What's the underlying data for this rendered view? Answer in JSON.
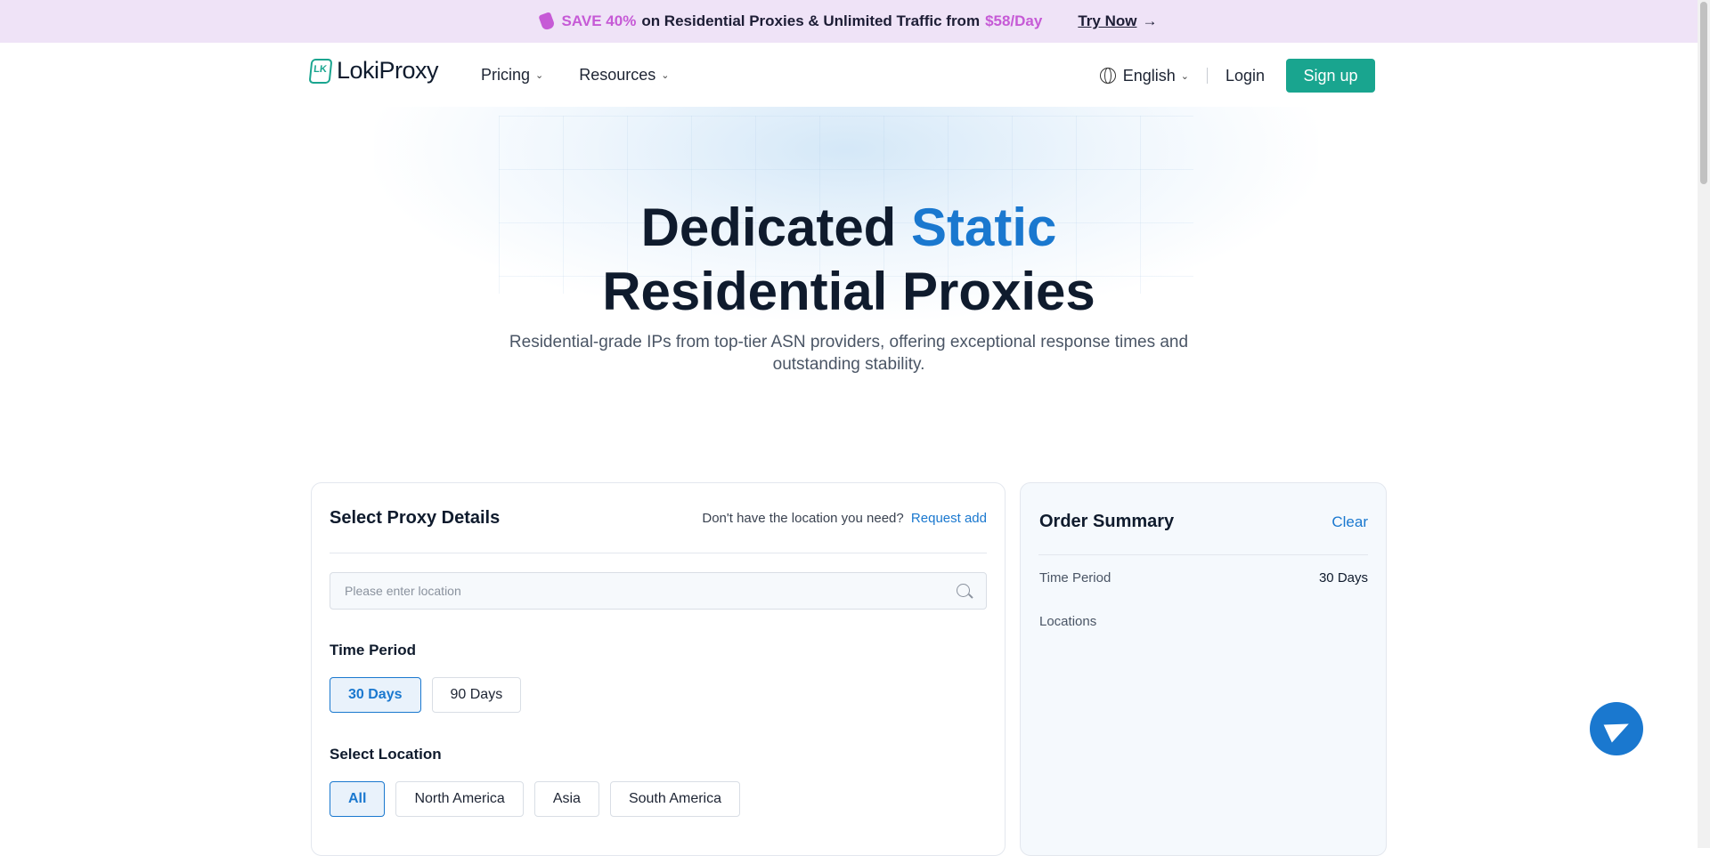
{
  "promo": {
    "save": "SAVE 40%",
    "text": "on Residential Proxies & Unlimited Traffic from",
    "price": "$58/Day",
    "cta": "Try Now",
    "arrow": "→",
    "accent_color": "#c65ad6"
  },
  "header": {
    "logo": "LokiProxy",
    "nav": [
      {
        "label": "Pricing"
      },
      {
        "label": "Resources"
      }
    ],
    "chevron": "⌄",
    "language": "English",
    "login": "Login",
    "signup": "Sign up",
    "brand_color": "#19a58f"
  },
  "hero": {
    "title_part1": "Dedicated ",
    "title_accent": "Static",
    "title_part2": " Residential Proxies",
    "subtitle": "Residential-grade IPs from top-tier ASN providers, offering exceptional response times and outstanding stability.",
    "accent_color": "#1a78cf"
  },
  "proxy_details": {
    "title": "Select Proxy Details",
    "request_prefix": "Don't have the location you need?",
    "request_link": "Request add",
    "search_placeholder": "Please enter location",
    "time_period_label": "Time Period",
    "time_options": [
      "30 Days",
      "90 Days"
    ],
    "time_selected": "30 Days",
    "location_label": "Select Location",
    "location_options": [
      "All",
      "North America",
      "Asia",
      "South America"
    ],
    "location_selected": "All"
  },
  "order_summary": {
    "title": "Order Summary",
    "clear": "Clear",
    "time_period_label": "Time Period",
    "time_period_value": "30 Days",
    "locations_label": "Locations"
  },
  "icons": [
    "tag-icon",
    "globe-icon",
    "search-icon",
    "telegram-icon",
    "chevron-down-icon"
  ]
}
